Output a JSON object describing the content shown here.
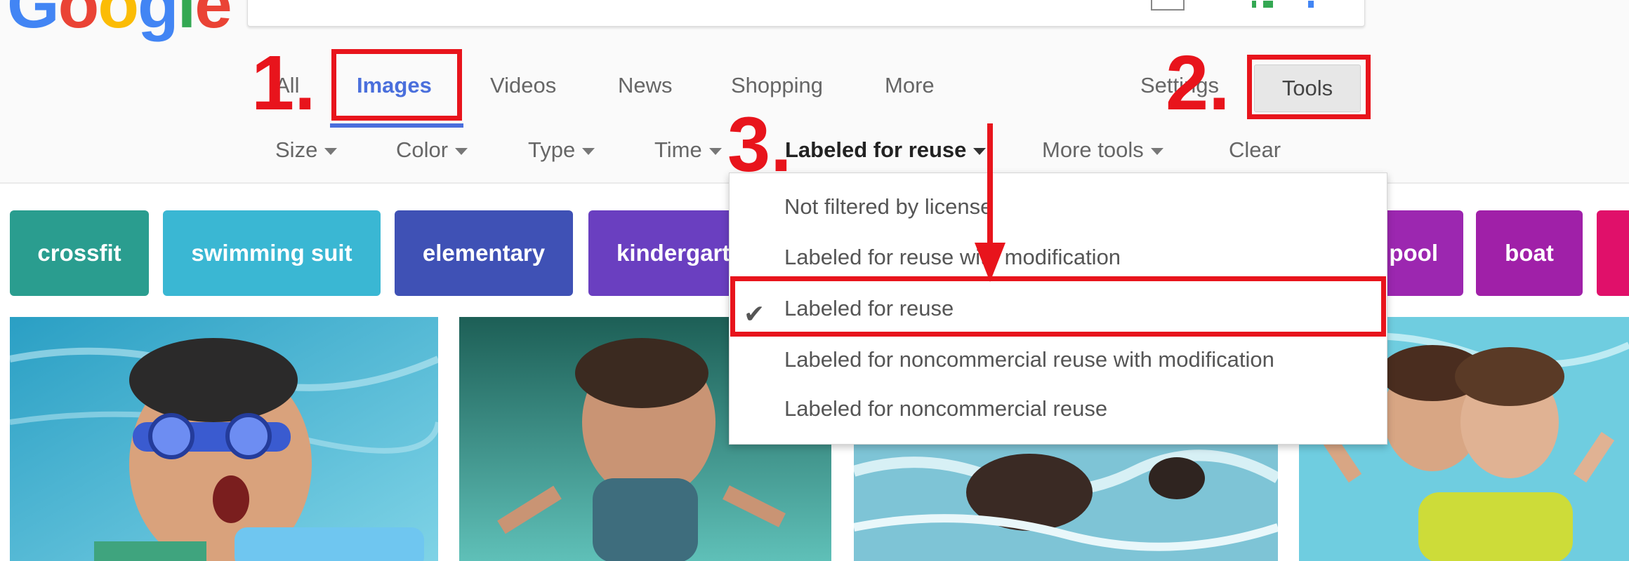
{
  "logo": "Google",
  "tabs": [
    {
      "label": "All"
    },
    {
      "label": "Images"
    },
    {
      "label": "Videos"
    },
    {
      "label": "News"
    },
    {
      "label": "Shopping"
    },
    {
      "label": "More"
    }
  ],
  "settings_label": "Settings",
  "tools_label": "Tools",
  "filters": [
    {
      "label": "Size"
    },
    {
      "label": "Color"
    },
    {
      "label": "Type"
    },
    {
      "label": "Time"
    },
    {
      "label": "Labeled for reuse"
    },
    {
      "label": "More tools"
    }
  ],
  "clear_label": "Clear",
  "chips": [
    {
      "label": "crossfit",
      "color": "#2a9d8f"
    },
    {
      "label": "swimming suit",
      "color": "#3ab7d3"
    },
    {
      "label": "elementary",
      "color": "#3f51b5"
    },
    {
      "label": "kindergarten",
      "color": "#6a3fc0"
    },
    {
      "label": "pool",
      "color": "#9c27b0"
    },
    {
      "label": "boat",
      "color": "#a020a8"
    },
    {
      "label": "",
      "color": "#e0106a"
    }
  ],
  "license_menu": {
    "items": [
      {
        "label": "Not filtered by license"
      },
      {
        "label": "Labeled for reuse with modification"
      },
      {
        "label": "Labeled for reuse"
      },
      {
        "label": "Labeled for noncommercial reuse with modification"
      },
      {
        "label": "Labeled for noncommercial reuse"
      }
    ],
    "selected_index": 2,
    "check_icon": "checkmark-icon"
  },
  "annotations": {
    "step1": "1.",
    "step2": "2.",
    "step3": "3.",
    "accent_color": "#e8141c"
  },
  "colors": {
    "active_tab": "#4a6fdc",
    "annotation_red": "#e8141c"
  }
}
